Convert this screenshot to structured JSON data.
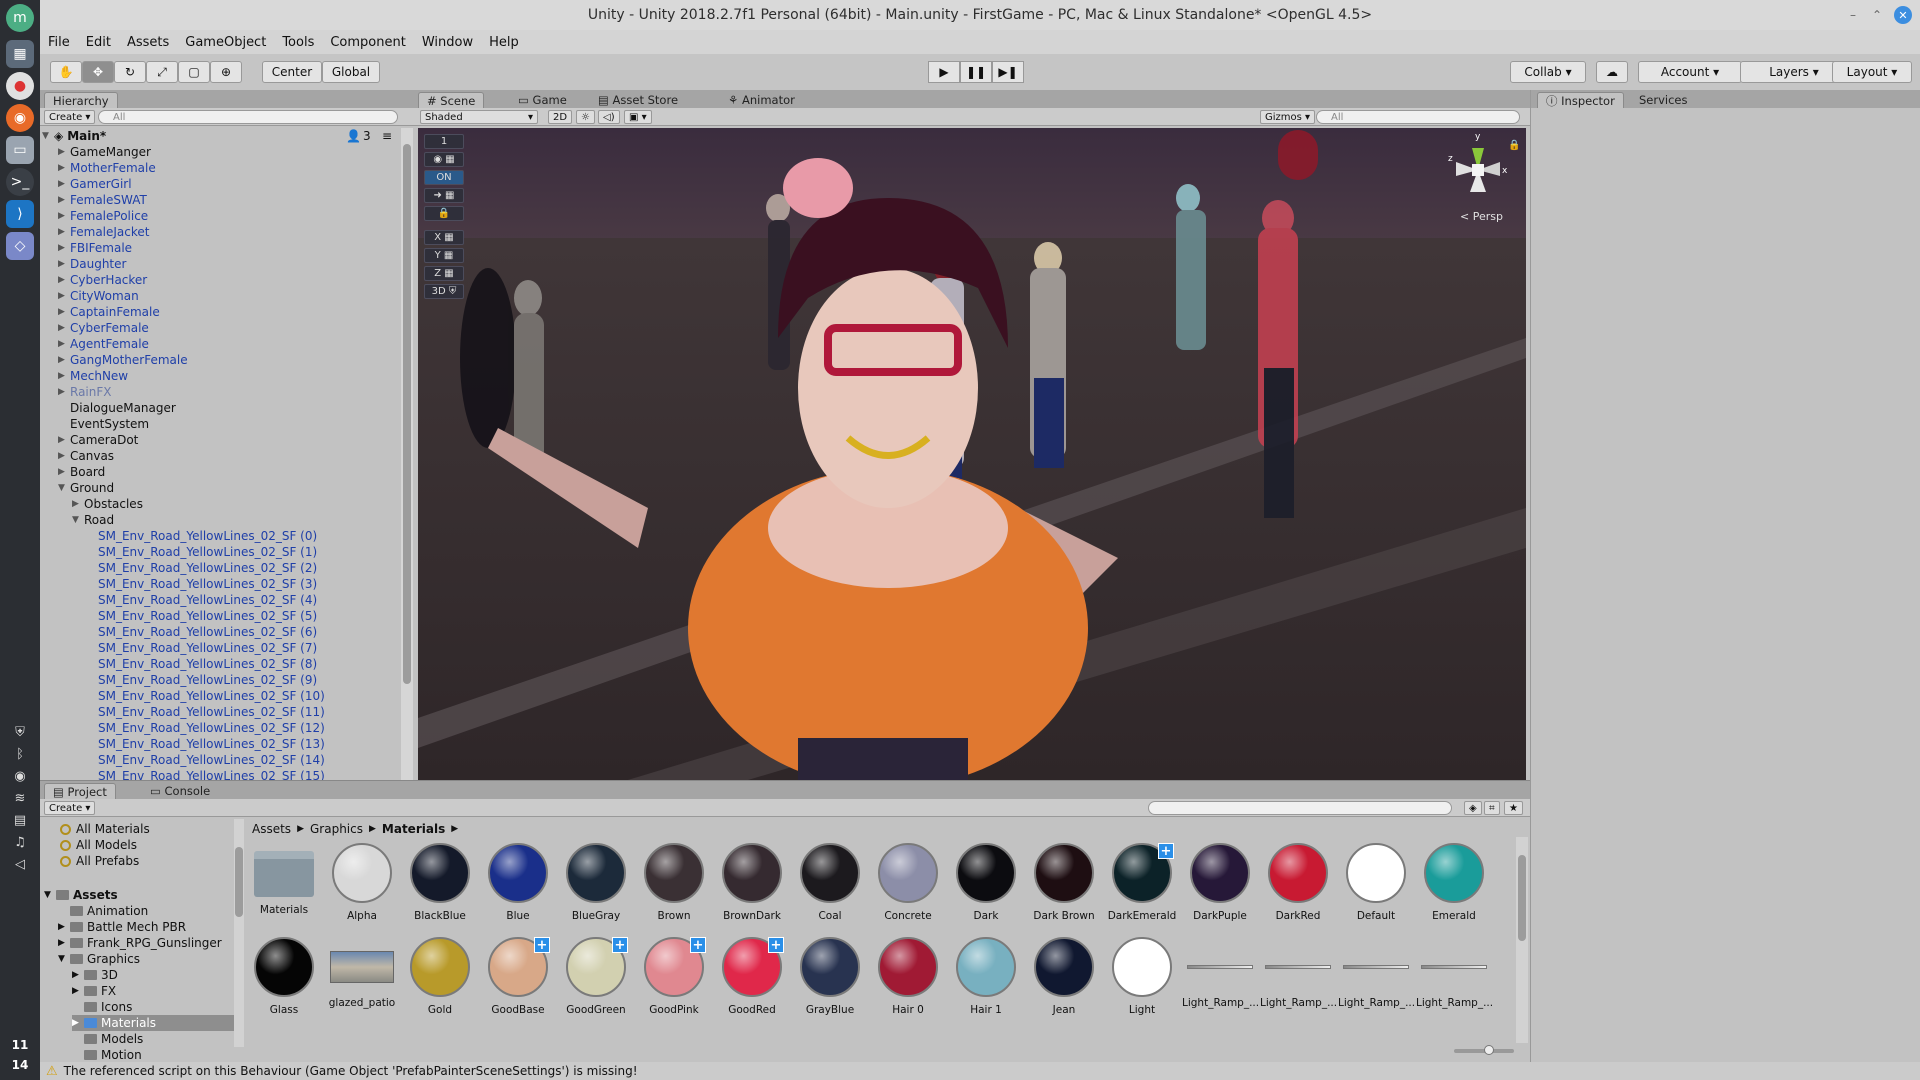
{
  "dock": {
    "time_hour": "11",
    "time_minute": "14"
  },
  "window": {
    "title": "Unity - Unity 2018.2.7f1 Personal (64bit) - Main.unity - FirstGame - PC, Mac & Linux Standalone* <OpenGL 4.5>"
  },
  "menu": [
    "File",
    "Edit",
    "Assets",
    "GameObject",
    "Tools",
    "Component",
    "Window",
    "Help"
  ],
  "toolbar": {
    "pivot": "Center",
    "space": "Global",
    "collab": "Collab",
    "account": "Account",
    "layers": "Layers",
    "layout": "Layout"
  },
  "hierarchy": {
    "tab": "Hierarchy",
    "create": "Create",
    "search_placeholder": "All",
    "scene_name": "Main*",
    "user_count": "3",
    "rows": [
      {
        "label": "GameManger",
        "arrow": "▶",
        "indent": 1,
        "style": "normal"
      },
      {
        "label": "MotherFemale",
        "arrow": "▶",
        "indent": 1,
        "style": "blue"
      },
      {
        "label": "GamerGirl",
        "arrow": "▶",
        "indent": 1,
        "style": "blue"
      },
      {
        "label": "FemaleSWAT",
        "arrow": "▶",
        "indent": 1,
        "style": "blue"
      },
      {
        "label": "FemalePolice",
        "arrow": "▶",
        "indent": 1,
        "style": "blue"
      },
      {
        "label": "FemaleJacket",
        "arrow": "▶",
        "indent": 1,
        "style": "blue"
      },
      {
        "label": "FBIFemale",
        "arrow": "▶",
        "indent": 1,
        "style": "blue"
      },
      {
        "label": "Daughter",
        "arrow": "▶",
        "indent": 1,
        "style": "blue"
      },
      {
        "label": "CyberHacker",
        "arrow": "▶",
        "indent": 1,
        "style": "blue"
      },
      {
        "label": "CityWoman",
        "arrow": "▶",
        "indent": 1,
        "style": "blue"
      },
      {
        "label": "CaptainFemale",
        "arrow": "▶",
        "indent": 1,
        "style": "blue"
      },
      {
        "label": "CyberFemale",
        "arrow": "▶",
        "indent": 1,
        "style": "blue"
      },
      {
        "label": "AgentFemale",
        "arrow": "▶",
        "indent": 1,
        "style": "blue"
      },
      {
        "label": "GangMotherFemale",
        "arrow": "▶",
        "indent": 1,
        "style": "blue"
      },
      {
        "label": "MechNew",
        "arrow": "▶",
        "indent": 1,
        "style": "blue"
      },
      {
        "label": "RainFX",
        "arrow": "▶",
        "indent": 1,
        "style": "muted"
      },
      {
        "label": "DialogueManager",
        "arrow": "",
        "indent": 1,
        "style": "normal"
      },
      {
        "label": "EventSystem",
        "arrow": "",
        "indent": 1,
        "style": "normal"
      },
      {
        "label": "CameraDot",
        "arrow": "▶",
        "indent": 1,
        "style": "normal"
      },
      {
        "label": "Canvas",
        "arrow": "▶",
        "indent": 1,
        "style": "normal"
      },
      {
        "label": "Board",
        "arrow": "▶",
        "indent": 1,
        "style": "normal"
      },
      {
        "label": "Ground",
        "arrow": "▼",
        "indent": 1,
        "style": "normal"
      },
      {
        "label": "Obstacles",
        "arrow": "▶",
        "indent": 2,
        "style": "normal"
      },
      {
        "label": "Road",
        "arrow": "▼",
        "indent": 2,
        "style": "normal"
      },
      {
        "label": "SM_Env_Road_YellowLines_02_SF (0)",
        "arrow": "",
        "indent": 3,
        "style": "blue"
      },
      {
        "label": "SM_Env_Road_YellowLines_02_SF (1)",
        "arrow": "",
        "indent": 3,
        "style": "blue"
      },
      {
        "label": "SM_Env_Road_YellowLines_02_SF (2)",
        "arrow": "",
        "indent": 3,
        "style": "blue"
      },
      {
        "label": "SM_Env_Road_YellowLines_02_SF (3)",
        "arrow": "",
        "indent": 3,
        "style": "blue"
      },
      {
        "label": "SM_Env_Road_YellowLines_02_SF (4)",
        "arrow": "",
        "indent": 3,
        "style": "blue"
      },
      {
        "label": "SM_Env_Road_YellowLines_02_SF (5)",
        "arrow": "",
        "indent": 3,
        "style": "blue"
      },
      {
        "label": "SM_Env_Road_YellowLines_02_SF (6)",
        "arrow": "",
        "indent": 3,
        "style": "blue"
      },
      {
        "label": "SM_Env_Road_YellowLines_02_SF (7)",
        "arrow": "",
        "indent": 3,
        "style": "blue"
      },
      {
        "label": "SM_Env_Road_YellowLines_02_SF (8)",
        "arrow": "",
        "indent": 3,
        "style": "blue"
      },
      {
        "label": "SM_Env_Road_YellowLines_02_SF (9)",
        "arrow": "",
        "indent": 3,
        "style": "blue"
      },
      {
        "label": "SM_Env_Road_YellowLines_02_SF (10)",
        "arrow": "",
        "indent": 3,
        "style": "blue"
      },
      {
        "label": "SM_Env_Road_YellowLines_02_SF (11)",
        "arrow": "",
        "indent": 3,
        "style": "blue"
      },
      {
        "label": "SM_Env_Road_YellowLines_02_SF (12)",
        "arrow": "",
        "indent": 3,
        "style": "blue"
      },
      {
        "label": "SM_Env_Road_YellowLines_02_SF (13)",
        "arrow": "",
        "indent": 3,
        "style": "blue"
      },
      {
        "label": "SM_Env_Road_YellowLines_02_SF (14)",
        "arrow": "",
        "indent": 3,
        "style": "blue"
      },
      {
        "label": "SM_Env_Road_YellowLines_02_SF (15)",
        "arrow": "",
        "indent": 3,
        "style": "blue"
      }
    ]
  },
  "scene": {
    "tabs": [
      "Scene",
      "Game",
      "Asset Store",
      "Animator"
    ],
    "shading": "Shaded",
    "mode_2d": "2D",
    "gizmos": "Gizmos",
    "search_placeholder": "All",
    "projection": "< Persp",
    "side_tools": [
      "1",
      "ON",
      "X",
      "Y",
      "Z",
      "3D"
    ],
    "axes": {
      "x": "x",
      "y": "y",
      "z": "z"
    }
  },
  "inspector": {
    "tabs": [
      "Inspector",
      "Services"
    ]
  },
  "project": {
    "tabs": [
      "Project",
      "Console"
    ],
    "create": "Create",
    "breadcrumb": [
      "Assets",
      "Graphics",
      "Materials"
    ],
    "favorites": [
      "All Materials",
      "All Models",
      "All Prefabs"
    ],
    "tree": [
      {
        "label": "Assets",
        "arrow": "▼",
        "indent": 0,
        "bold": true
      },
      {
        "label": "Animation",
        "arrow": "",
        "indent": 1
      },
      {
        "label": "Battle Mech PBR",
        "arrow": "▶",
        "indent": 1
      },
      {
        "label": "Frank_RPG_Gunslinger",
        "arrow": "▶",
        "indent": 1
      },
      {
        "label": "Graphics",
        "arrow": "▼",
        "indent": 1
      },
      {
        "label": "3D",
        "arrow": "▶",
        "indent": 2
      },
      {
        "label": "FX",
        "arrow": "▶",
        "indent": 2
      },
      {
        "label": "Icons",
        "arrow": "",
        "indent": 2
      },
      {
        "label": "Materials",
        "arrow": "▶",
        "indent": 2,
        "selected": true
      },
      {
        "label": "Models",
        "arrow": "",
        "indent": 2
      },
      {
        "label": "Motion",
        "arrow": "",
        "indent": 2
      }
    ],
    "assets_row1": [
      {
        "name": "Materials",
        "kind": "folder"
      },
      {
        "name": "Alpha",
        "color": "#d8d8d8"
      },
      {
        "name": "BlackBlue",
        "color": "#141a2a"
      },
      {
        "name": "Blue",
        "color": "#1a2f8a"
      },
      {
        "name": "BlueGray",
        "color": "#1c2a3a"
      },
      {
        "name": "Brown",
        "color": "#3a3034"
      },
      {
        "name": "BrownDark",
        "color": "#352a30"
      },
      {
        "name": "Coal",
        "color": "#1c1a1e"
      },
      {
        "name": "Concrete",
        "color": "#8c8ea8"
      },
      {
        "name": "Dark",
        "color": "#0c0c10"
      },
      {
        "name": "Dark Brown",
        "color": "#1e0e12"
      },
      {
        "name": "DarkEmerald",
        "color": "#0c2228",
        "plus": true
      },
      {
        "name": "DarkPuple",
        "color": "#261838"
      },
      {
        "name": "DarkRed",
        "color": "#c81a32"
      },
      {
        "name": "Default",
        "color": "#ffffff"
      },
      {
        "name": "Emerald",
        "color": "#1a9c9a"
      }
    ],
    "assets_row2": [
      {
        "name": "Glass",
        "color": "#050505"
      },
      {
        "name": "glazed_patio",
        "kind": "texture"
      },
      {
        "name": "Gold",
        "color": "#b89a2a"
      },
      {
        "name": "GoodBase",
        "color": "#d8a888",
        "plus": true
      },
      {
        "name": "GoodGreen",
        "color": "#d2d0b0",
        "plus": true
      },
      {
        "name": "GoodPink",
        "color": "#e08890",
        "plus": true
      },
      {
        "name": "GoodRed",
        "color": "#e0284a",
        "plus": true
      },
      {
        "name": "GrayBlue",
        "color": "#283350"
      },
      {
        "name": "Hair 0",
        "color": "#a01a34"
      },
      {
        "name": "Hair 1",
        "color": "#78b0c0"
      },
      {
        "name": "Jean",
        "color": "#101830"
      },
      {
        "name": "Light",
        "color": "#ffffff"
      },
      {
        "name": "Light_Ramp_...",
        "kind": "ramp"
      },
      {
        "name": "Light_Ramp_...",
        "kind": "ramp"
      },
      {
        "name": "Light_Ramp_...",
        "kind": "ramp"
      },
      {
        "name": "Light_Ramp_...",
        "kind": "ramp"
      }
    ]
  },
  "status": {
    "message": "The referenced script on this Behaviour (Game Object 'PrefabPainterSceneSettings') is missing!"
  }
}
